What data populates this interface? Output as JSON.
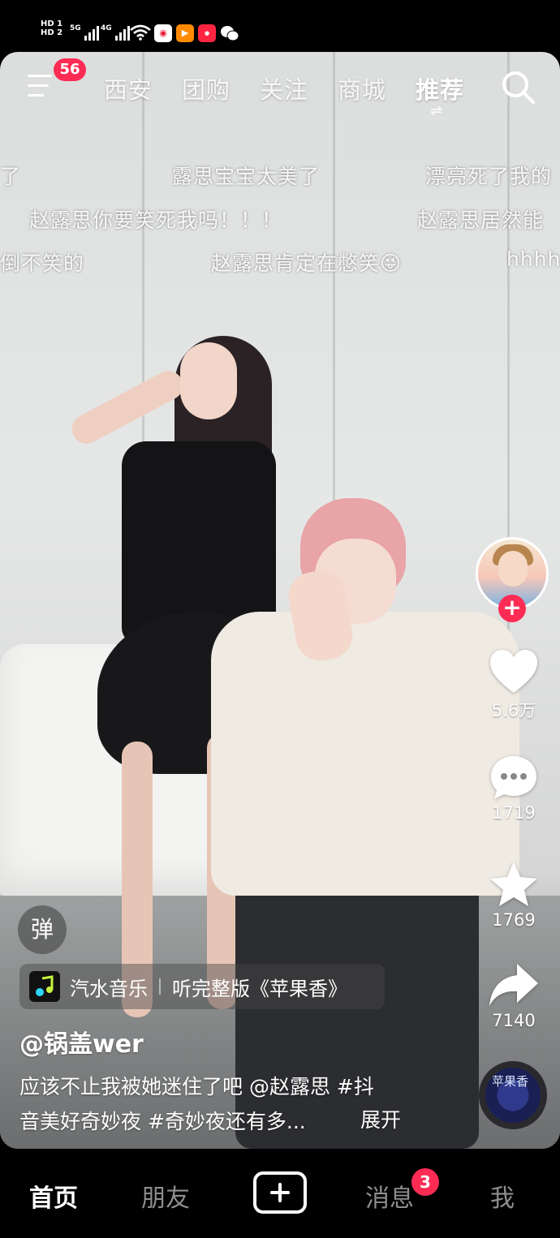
{
  "status_bar": {
    "hd1": "HD 1",
    "hd2": "HD 2",
    "net1": "5G",
    "net2": "4G",
    "apps": [
      "weibo-icon",
      "player-icon",
      "xiaohongshu-icon",
      "wechat-icon"
    ]
  },
  "top_nav": {
    "notification_count": "56",
    "tabs": [
      {
        "label": "西安"
      },
      {
        "label": "团购"
      },
      {
        "label": "关注"
      },
      {
        "label": "商城"
      },
      {
        "label": "推荐"
      }
    ],
    "active_tab": "推荐",
    "active_indicator": "⇌"
  },
  "danmaku": [
    {
      "text": "了"
    },
    {
      "text": "露思宝宝太美了"
    },
    {
      "text": "漂亮死了我的"
    },
    {
      "text": "赵露思你要笑死我吗！！！"
    },
    {
      "text": "赵露思居然能"
    },
    {
      "text": "倒不笑的"
    },
    {
      "text": "赵露思肯定在憋笑😜"
    },
    {
      "text": "hhhh"
    }
  ],
  "right_rail": {
    "like_count": "5.6万",
    "comment_count": "1719",
    "favorite_count": "1769",
    "share_count": "7140",
    "disc_label": "苹果香"
  },
  "video_info": {
    "danmu_toggle": "弹",
    "music_app": "汽水音乐",
    "music_prompt": "听完整版《苹果香》",
    "author": "@锅盖wer",
    "caption_line1": "应该不止我被她迷住了吧 @赵露思 #抖",
    "caption_line2": "音美好奇妙夜 #奇妙夜还有多...",
    "expand_label": "展开"
  },
  "tab_bar": {
    "home": "首页",
    "friends": "朋友",
    "messages": "消息",
    "message_badge": "3",
    "me": "我"
  },
  "colors": {
    "accent": "#fe2c55",
    "background": "#000000",
    "inactive_tab": "#8e8e8e"
  }
}
